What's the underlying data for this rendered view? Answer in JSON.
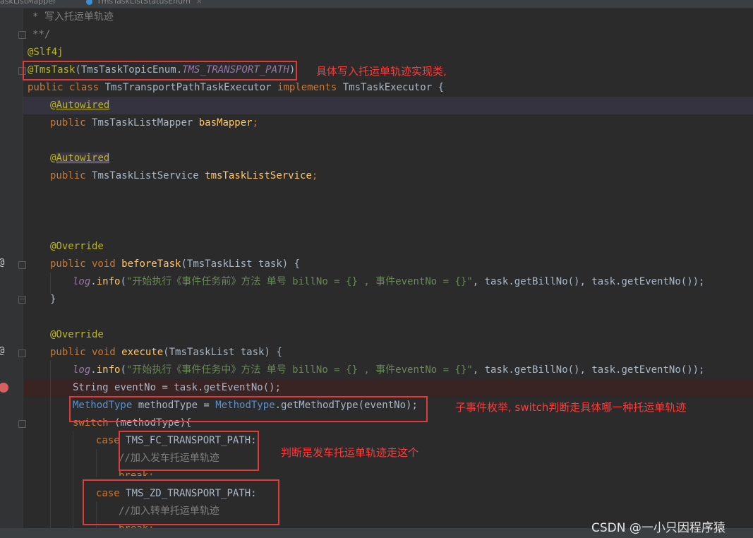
{
  "tabs": [
    {
      "label": "askListMapper"
    },
    {
      "label": "TmsTaskListStatusEnum"
    }
  ],
  "code": {
    "l1": "* 写入托运单轨迹",
    "l2": "**/",
    "l3": "@Slf4j",
    "l4_at": "@TmsTask",
    "l4_rest1": "(",
    "l4_enum": "TmsTaskTopicEnum",
    "l4_dot": ".",
    "l4_const": "TMS_TRANSPORT_PATH",
    "l4_close": ")",
    "l5_kw1": "public class ",
    "l5_cls": "TmsTransportPathTaskExecutor ",
    "l5_kw2": "implements ",
    "l5_iface": "TmsTaskExecutor",
    "l5_brace": " {",
    "l6_at": "@",
    "l6_name": "Autowired",
    "l7_kw": "public ",
    "l7_type": "TmsTaskListMapper ",
    "l7_field": "basMapper",
    "l7_semi": ";",
    "l9_at": "@",
    "l9_name": "Autowired",
    "l10_kw": "public ",
    "l10_type": "TmsTaskListService ",
    "l10_field": "tmsTaskListService",
    "l10_semi": ";",
    "l14": "@Override",
    "l15_kw": "public void ",
    "l15_fn": "beforeTask",
    "l15_p1": "(",
    "l15_type": "TmsTaskList",
    "l15_rest": " task) {",
    "l16_log": "log",
    "l16_dot": ".",
    "l16_info": "info",
    "l16_open": "(",
    "l16_str": "\"开始执行《事件任务前》方法 单号 billNo = {} , 事件eventNo = {}\"",
    "l16_rest": ", task.getBillNo(), task.getEventNo());",
    "l17": "}",
    "l19": "@Override",
    "l20_kw": "public void ",
    "l20_fn": "execute",
    "l20_p1": "(",
    "l20_type": "TmsTaskList",
    "l20_rest": " task) {",
    "l21_log": "log",
    "l21_dot": ".",
    "l21_info": "info",
    "l21_open": "(",
    "l21_str": "\"开始执行《事件任务中》方法 单号 billNo = {} , 事件eventNo = {}\"",
    "l21_rest": ", task.getBillNo(), task.getEventNo());",
    "l22_type": "String ",
    "l22_rest": "eventNo = task.getEventNo();",
    "l23_type": "MethodType ",
    "l23_mid": "methodType = ",
    "l23_type2": "MethodType",
    "l23_rest": ".getMethodType(eventNo);",
    "l24_kw": "switch ",
    "l24_rest": "(methodType){",
    "l25_kw": "case ",
    "l25_const": "TMS_FC_TRANSPORT_PATH",
    "l25_colon": ":",
    "l26": "//加入发车托运单轨迹",
    "l27": "break;",
    "l28_kw": "case ",
    "l28_const": "TMS_ZD_TRANSPORT_PATH",
    "l28_colon": ":",
    "l29": "//加入转单托运单轨迹",
    "l30": "break;"
  },
  "annotations": {
    "note1": "具体写入托运单轨迹实现类,",
    "note2": "子事件枚举, switch判断走具体哪一种托运单轨迹",
    "note3": "判断是发车托运单轨迹走这个"
  },
  "watermark": "CSDN @一小只因程序猿",
  "gutter_icons": {
    "override": "@"
  },
  "colors": {
    "annotation_box": "#e03b3b",
    "annotation_text": "#ff3b3b",
    "background": "#2b2b2b"
  }
}
